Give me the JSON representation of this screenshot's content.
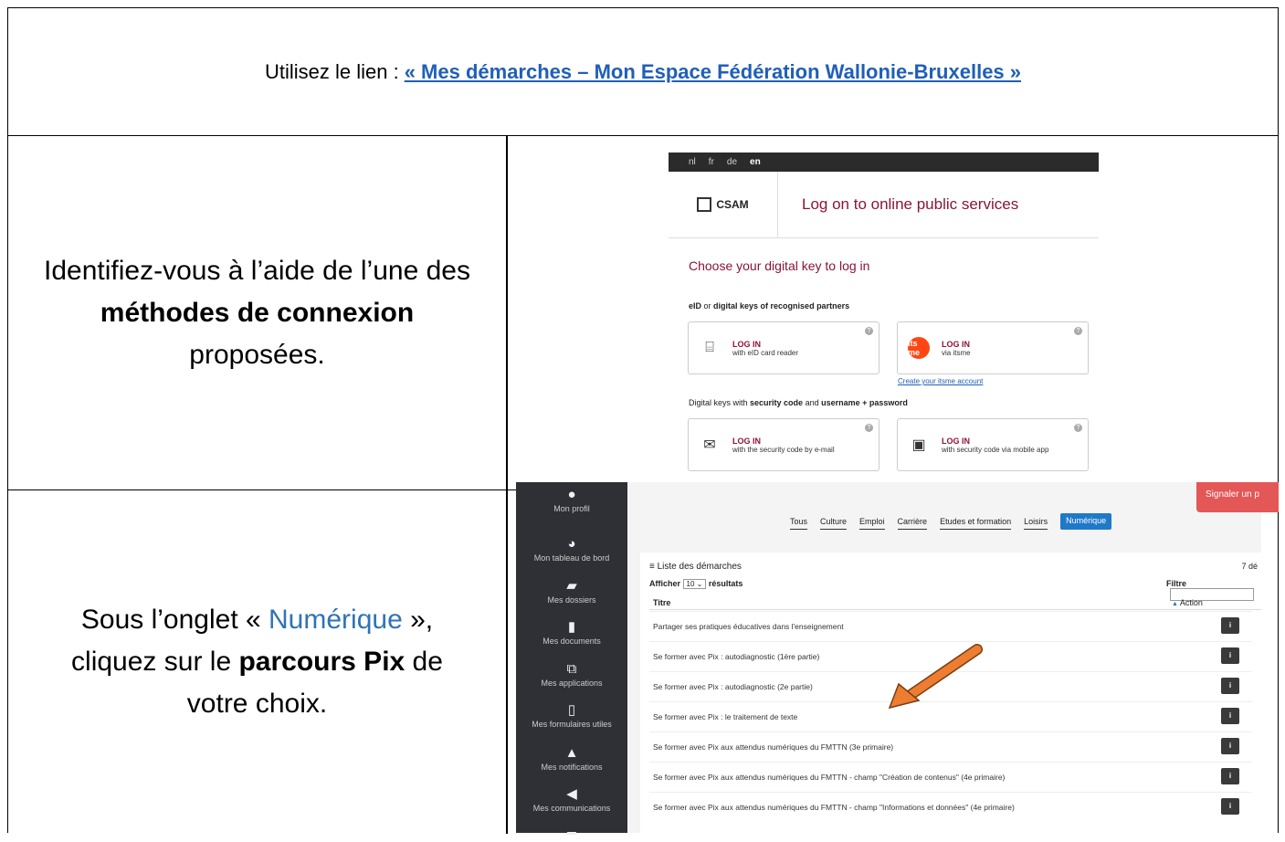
{
  "row1": {
    "prefix": "Utilisez le lien :",
    "link": "« Mes démarches – Mon Espace Fédération Wallonie-Bruxelles »"
  },
  "row2": {
    "text1": "Identifiez-vous à l’aide de l’une des ",
    "bold": "méthodes de connexion",
    "text2": " proposées."
  },
  "row3": {
    "text1": "Sous l’onglet « ",
    "tab": "Numérique",
    "text2": " », cliquez sur le ",
    "bold": "parcours Pix",
    "text3": " de votre choix."
  },
  "csam": {
    "langs": [
      "nl",
      "fr",
      "de",
      "en"
    ],
    "logo": "CSAM",
    "title": "Log on to online public services",
    "choose": "Choose your digital key to log in",
    "sub1_a": "eID",
    "sub1_b": " or ",
    "sub1_c": "digital keys of recognised partners",
    "sub2_a": "Digital keys with ",
    "sub2_b": "security code",
    "sub2_c": " and ",
    "sub2_d": "username + password",
    "cards": [
      {
        "t1": "LOG IN",
        "t2": "with eID card reader",
        "icon": "card-reader-icon"
      },
      {
        "t1": "LOG IN",
        "t2": "via itsme",
        "icon": "itsme-icon",
        "iconText": "its me"
      },
      {
        "t1": "LOG IN",
        "t2": "with the security code by e-mail",
        "icon": "mail-icon"
      },
      {
        "t1": "LOG IN",
        "t2": "with security code via mobile app",
        "icon": "mobile-app-icon"
      }
    ],
    "create": "Create your itsme account",
    "help": "?"
  },
  "sidebar": [
    {
      "label": "Mon profil",
      "icon": "profile-icon"
    },
    {
      "label": "Mon tableau de bord",
      "icon": "dashboard-icon"
    },
    {
      "label": "Mes dossiers",
      "icon": "folder-icon"
    },
    {
      "label": "Mes documents",
      "icon": "document-icon"
    },
    {
      "label": "Mes applications",
      "icon": "applications-icon"
    },
    {
      "label": "Mes formulaires utiles",
      "icon": "pdf-form-icon"
    },
    {
      "label": "Mes notifications",
      "icon": "bell-icon"
    },
    {
      "label": "Mes communications",
      "icon": "megaphone-icon"
    }
  ],
  "portal": {
    "signal": "Signaler un p",
    "tabs": [
      "Tous",
      "Culture",
      "Emploi",
      "Carrière",
      "Etudes et formation",
      "Loisirs",
      "Numérique"
    ],
    "listTitle": "Liste des démarches",
    "count": "7 dé",
    "show_a": "Afficher",
    "show_val": "10",
    "show_b": "résultats",
    "filter": "Filtre",
    "colTitle": "Titre",
    "colAction": "Action",
    "btn": "i",
    "rows": [
      "Partager ses pratiques éducatives dans l'enseignement",
      "Se former avec Pix : autodiagnostic (1ère partie)",
      "Se former avec Pix : autodiagnostic (2e partie)",
      "Se former avec Pix : le traitement de texte",
      "Se former avec Pix aux attendus numériques du FMTTN (3e primaire)",
      "Se former avec Pix aux attendus numériques du FMTTN - champ \"Création de contenus\" (4e primaire)",
      "Se former avec Pix aux attendus numériques du FMTTN - champ \"Informations et données\" (4e primaire)"
    ]
  },
  "colors": {
    "link": "#1f5fb8",
    "csamAccent": "#8a1538",
    "tabActive": "#1f79c9",
    "arrow": "#ed7d31"
  }
}
